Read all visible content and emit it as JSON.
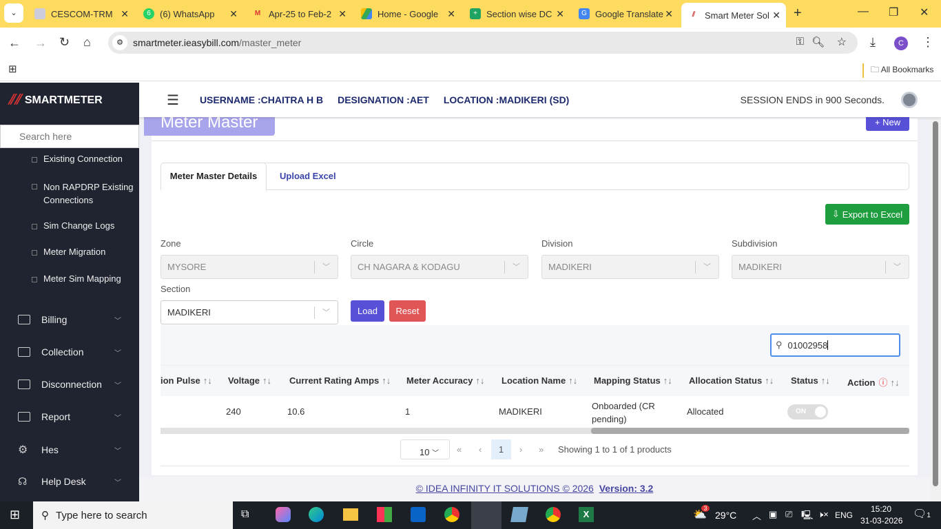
{
  "browser": {
    "tabs": [
      {
        "title": "CESCOM-TRM",
        "icon": "cescom-icon"
      },
      {
        "title": "(6) WhatsApp",
        "icon": "whatsapp-icon",
        "badge": "6"
      },
      {
        "title": "Apr-25 to Feb-2",
        "icon": "gmail-icon"
      },
      {
        "title": "Home - Google",
        "icon": "google-drive-icon"
      },
      {
        "title": "Section wise DC",
        "icon": "google-sheets-icon"
      },
      {
        "title": "Google Translate",
        "icon": "google-translate-icon"
      },
      {
        "title": "Smart Meter Sol",
        "icon": "smartmeter-icon",
        "active": true
      }
    ],
    "url_host": "smartmeter.ieasybill.com",
    "url_path": "/master_meter",
    "profile_initial": "C",
    "bookmarks_label": "All Bookmarks"
  },
  "sidebar": {
    "brand": "SMARTMETER",
    "search_placeholder": "Search here",
    "subitems": [
      "Existing Connection",
      "Non RAPDRP Existing Connections",
      "Sim Change Logs",
      "Meter Migration",
      "Meter Sim Mapping"
    ],
    "menus": [
      "Billing",
      "Collection",
      "Disconnection",
      "Report",
      "Hes",
      "Help Desk"
    ]
  },
  "header": {
    "username": "USERNAME :CHAITRA H B",
    "designation": "DESIGNATION :AET",
    "location": "LOCATION :MADIKERI (SD)",
    "session": "SESSION ENDS in 900 Seconds."
  },
  "page": {
    "title": "Meter Master",
    "new_label": "+ New",
    "tabs": [
      "Meter Master Details",
      "Upload Excel"
    ],
    "export_label": "Export to Excel",
    "filters": [
      {
        "label": "Zone",
        "value": "MYSORE"
      },
      {
        "label": "Circle",
        "value": "CH NAGARA & KODAGU"
      },
      {
        "label": "Division",
        "value": "MADIKERI"
      },
      {
        "label": "Subdivision",
        "value": "MADIKERI"
      },
      {
        "label": "Section",
        "value": "MADIKERI"
      }
    ],
    "load_label": "Load",
    "reset_label": "Reset",
    "search_value": "01002958",
    "columns": [
      "ion Pulse",
      "Voltage",
      "Current Rating Amps",
      "Meter Accuracy",
      "Location Name",
      "Mapping Status",
      "Allocation Status",
      "Status",
      "Action"
    ],
    "rows": [
      {
        "voltage": "240",
        "current": "10.6",
        "accuracy": "1",
        "location": "MADIKERI",
        "mapping": "Onboarded (CR pending)",
        "allocation": "Allocated",
        "status": "ON"
      }
    ],
    "page_size": "10",
    "current_page": "1",
    "showing": "Showing 1 to 1 of 1 products"
  },
  "footer": {
    "copyright": "© IDEA INFINITY IT SOLUTIONS  © 2026",
    "version": "Version: 3.2"
  },
  "taskbar": {
    "search_placeholder": "Type here to search",
    "weather": "29°C",
    "weather_badge": "3",
    "lang": "ENG",
    "time": "15:20",
    "date": "31-03-2026",
    "notif": "1"
  },
  "colors": {
    "tabbar": "#fddb5f",
    "sidebar": "#1f2430",
    "primary": "#5851d8",
    "success": "#1e9e3e",
    "danger": "#e05555"
  }
}
